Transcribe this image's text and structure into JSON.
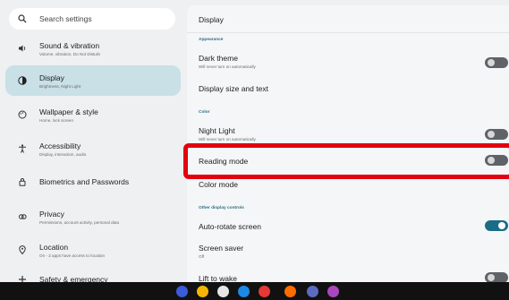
{
  "search": {
    "placeholder": "Search settings"
  },
  "sidebar": {
    "items": [
      {
        "label": "Sound & vibration",
        "sub": "Volume, vibration, Do Not Disturb",
        "icon": "speaker-icon"
      },
      {
        "label": "Display",
        "sub": "Brightness, Night Light",
        "icon": "brightness-icon",
        "active": true
      },
      {
        "label": "Wallpaper & style",
        "sub": "Home, lock screen",
        "icon": "palette-icon"
      },
      {
        "label": "Accessibility",
        "sub": "Display, interaction, audio",
        "icon": "accessibility-icon"
      },
      {
        "label": "Biometrics and Passwords",
        "sub": "",
        "icon": "lock-icon"
      },
      {
        "label": "Privacy",
        "sub": "Permissions, account activity, personal data",
        "icon": "privacy-icon"
      },
      {
        "label": "Location",
        "sub": "On - 2 apps have access to location",
        "icon": "location-icon"
      },
      {
        "label": "Safety & emergency",
        "sub": "",
        "icon": "emergency-icon"
      }
    ]
  },
  "main": {
    "title": "Display",
    "sections": {
      "appearance": "Appearance",
      "color": "Color",
      "other": "Other display controls"
    },
    "rows": {
      "dark_theme": {
        "title": "Dark theme",
        "sub": "Will never turn on automatically",
        "toggle": "off"
      },
      "display_size": {
        "title": "Display size and text"
      },
      "night_light": {
        "title": "Night Light",
        "sub": "Will never turn on automatically",
        "toggle": "off"
      },
      "reading_mode": {
        "title": "Reading mode",
        "toggle": "off"
      },
      "color_mode": {
        "title": "Color mode"
      },
      "auto_rotate": {
        "title": "Auto-rotate screen",
        "toggle": "on"
      },
      "screen_saver": {
        "title": "Screen saver",
        "sub": "Off"
      },
      "lift_to_wake": {
        "title": "Lift to wake",
        "toggle": "off"
      }
    }
  },
  "dock": {
    "apps": [
      {
        "name": "settings-app-icon",
        "color": "#3b5bd9"
      },
      {
        "name": "chrome-icon",
        "color": "#f2b705"
      },
      {
        "name": "camera-icon",
        "color": "#e6e6e6"
      },
      {
        "name": "gear-icon",
        "color": "#1e88e5"
      },
      {
        "name": "photos-icon",
        "color": "#e53935"
      },
      {
        "name": "play-store-icon",
        "color": "#ff6d00"
      },
      {
        "name": "messages-icon",
        "color": "#5c6bc0"
      },
      {
        "name": "apps-grid-icon",
        "color": "#ab47bc"
      }
    ]
  },
  "colors": {
    "accent": "#1b6c86",
    "active_bg": "#c8e0e6",
    "highlight": "#e3000f"
  }
}
